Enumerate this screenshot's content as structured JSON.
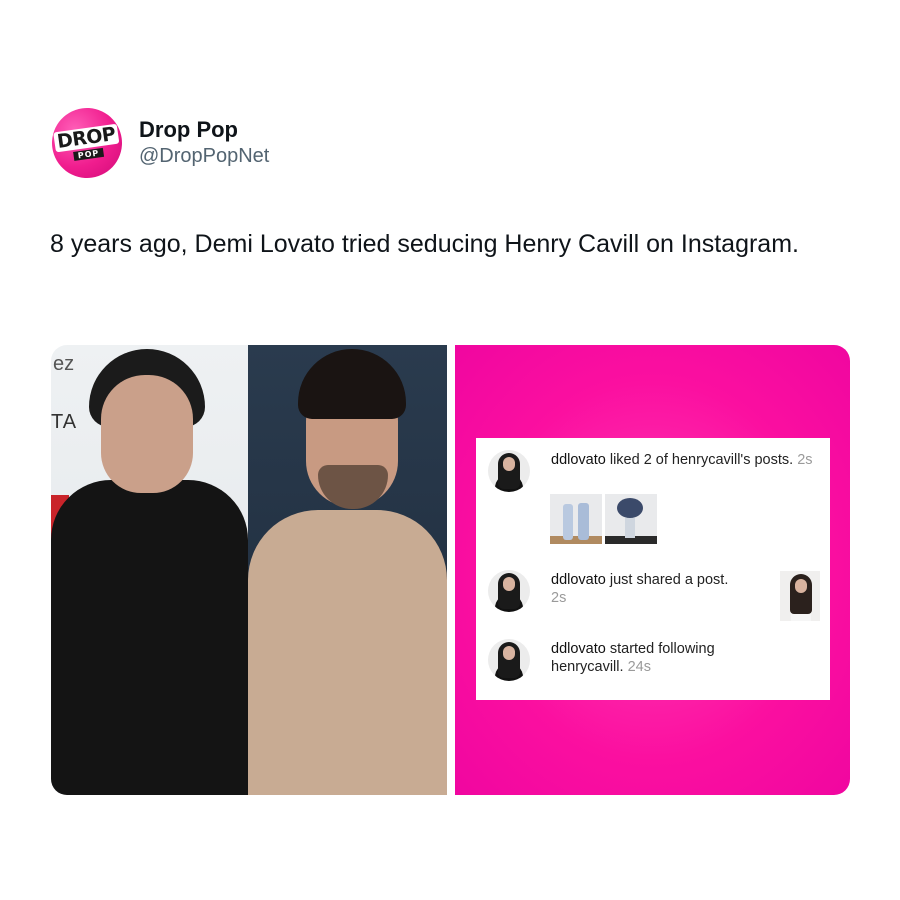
{
  "account": {
    "logo_main": "DROP",
    "logo_sub": "POP",
    "display_name": "Drop Pop",
    "handle": "@DropPopNet",
    "brand_color": "#f01d8e"
  },
  "tweet": {
    "text": "8 years ago, Demi Lovato tried seducing Henry Cavill on Instagram."
  },
  "media": {
    "left_photo_bg_text": "ez",
    "left_photo_bg_text2": "TA",
    "panel_color": "#fb0fa0",
    "notifications": [
      {
        "user": "ddlovato",
        "text": " liked 2 of henrycavill's posts.",
        "time": "2s"
      },
      {
        "user": "ddlovato",
        "text": " just shared a post.",
        "time": "2s"
      },
      {
        "user": "ddlovato",
        "text": " started following henrycavill.",
        "time": "24s"
      }
    ]
  }
}
